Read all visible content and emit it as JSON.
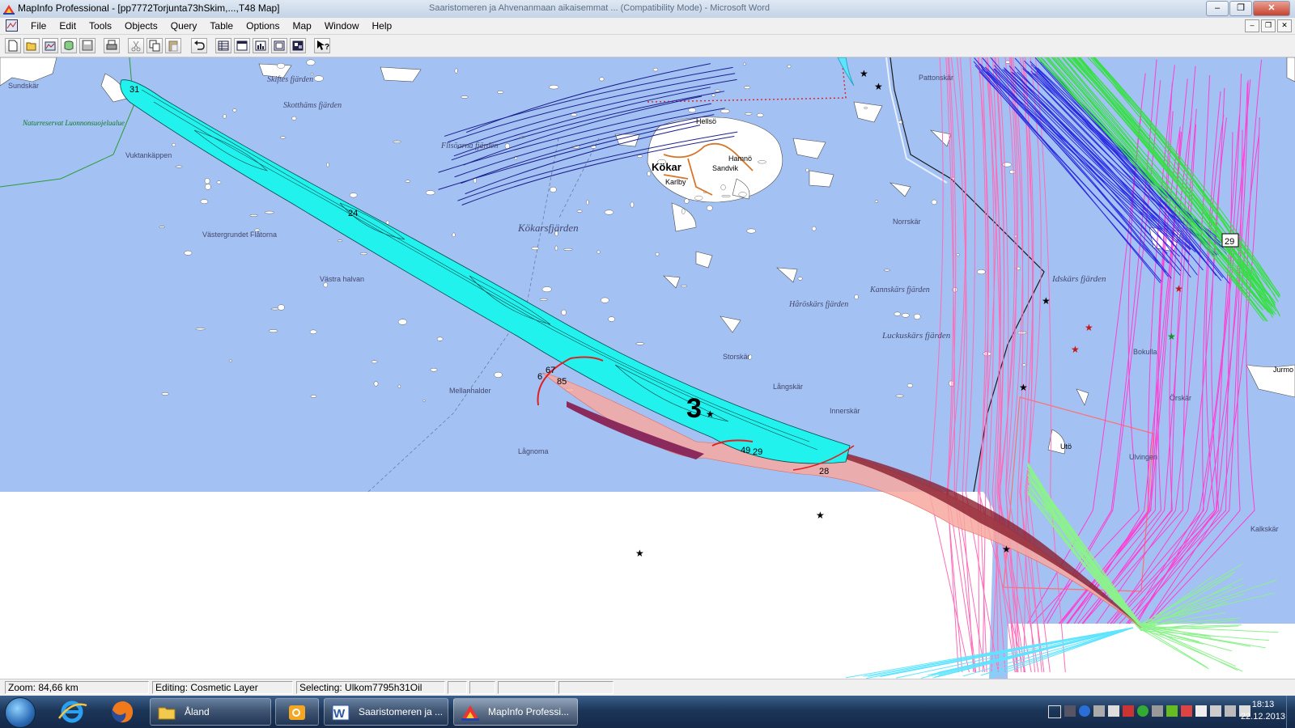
{
  "window": {
    "title": "MapInfo Professional - [pp7772Torjunta73hSkim,...,T48 Map]",
    "background_title": "Saaristomeren ja Ahvenanmaan aikaisemmat ... (Compatibility Mode) - Microsoft Word"
  },
  "menu": {
    "items": [
      "File",
      "Edit",
      "Tools",
      "Objects",
      "Query",
      "Table",
      "Options",
      "Map",
      "Window",
      "Help"
    ]
  },
  "toolbar": {
    "buttons": [
      "new-icon",
      "open-icon",
      "open-workspace-icon",
      "open-dbms-icon",
      "save-icon",
      "print-icon",
      "cut-icon",
      "copy-icon",
      "paste-icon",
      "undo-icon",
      "new-browser-icon",
      "new-mapper-icon",
      "new-grapher-icon",
      "new-layout-icon",
      "new-redistrict-icon",
      "help-pointer-icon"
    ]
  },
  "map": {
    "colors": {
      "sea": "#a3c1f3",
      "land": "#ffffff",
      "slick_cyan": "#22f2ee",
      "slick_pink": "#f7a8a0",
      "track_red": "#e02020",
      "magenta": "#ff2fd2",
      "blue": "#2323e0",
      "green": "#36e33f"
    },
    "place_labels": [
      {
        "id": "kokar",
        "text": "Kökar"
      },
      {
        "id": "kokarsfjarden",
        "text": "Kökarsfjärden"
      },
      {
        "id": "skiftesfjarden",
        "text": "Skiftes fjärden"
      },
      {
        "id": "skothamsfjarden",
        "text": "Skotthäms fjärden"
      },
      {
        "id": "flisofjarden",
        "text": "Flisöarna fjärden"
      },
      {
        "id": "hellso",
        "text": "Hellsö"
      },
      {
        "id": "karlby",
        "text": "Karlby"
      },
      {
        "id": "hamnoudden",
        "text": "Hamnö"
      },
      {
        "id": "sandvik",
        "text": "Sandvik"
      },
      {
        "id": "idskarsfjarden",
        "text": "Idskärs fjärden"
      },
      {
        "id": "luckuskarsfjarden",
        "text": "Luckuskärs fjärden"
      },
      {
        "id": "kannskarsfjarden",
        "text": "Kannskärs fjärden"
      },
      {
        "id": "harosskarsfjarden",
        "text": "Håröskärs fjärden"
      },
      {
        "id": "uto",
        "text": "Utö"
      },
      {
        "id": "jurmo",
        "text": "Jurmo"
      },
      {
        "id": "vastra_halvan",
        "text": "Västra halvan"
      },
      {
        "id": "mellanhalder",
        "text": "Mellanhalder"
      },
      {
        "id": "lagnoma",
        "text": "Lågnoma"
      },
      {
        "id": "vastergrundet",
        "text": "Västergrundet Flåtorna"
      },
      {
        "id": "vuktankappen",
        "text": "Vuktankäppen"
      },
      {
        "id": "naturreservat",
        "text": "Naturreservat Luonnonsuojelualue"
      },
      {
        "id": "sundskar",
        "text": "Sundskär"
      },
      {
        "id": "pattonskar",
        "text": "Pattonskär"
      },
      {
        "id": "storskar",
        "text": "Storskär"
      },
      {
        "id": "norrskar",
        "text": "Norrskär"
      },
      {
        "id": "langskar",
        "text": "Långskär"
      },
      {
        "id": "innerskar",
        "text": "Innerskär"
      },
      {
        "id": "ulvingen",
        "text": "Ulvingen"
      },
      {
        "id": "kalkskar",
        "text": "Kalkskär"
      },
      {
        "id": "orskar",
        "text": "Örskär"
      },
      {
        "id": "bokulla",
        "text": "Bokulla"
      }
    ],
    "number_labels": [
      "31",
      "24",
      "3",
      "67",
      "85",
      "6",
      "49",
      "29",
      "28",
      "29"
    ]
  },
  "status": {
    "zoom": "Zoom: 84,66 km",
    "editing": "Editing: Cosmetic Layer",
    "selecting": "Selecting: Ulkom7795h31Oil"
  },
  "taskbar": {
    "pinned": [
      "internet-explorer-icon",
      "firefox-icon"
    ],
    "tasks": [
      {
        "label": "Åland",
        "icon": "folder-icon"
      },
      {
        "label": "",
        "icon": "outlook-icon"
      },
      {
        "label": "Saaristomeren ja ...",
        "icon": "word-icon"
      },
      {
        "label": "MapInfo Professi...",
        "icon": "mapinfo-icon"
      }
    ],
    "clock_time": "18:13",
    "clock_date": "22.12.2013"
  }
}
